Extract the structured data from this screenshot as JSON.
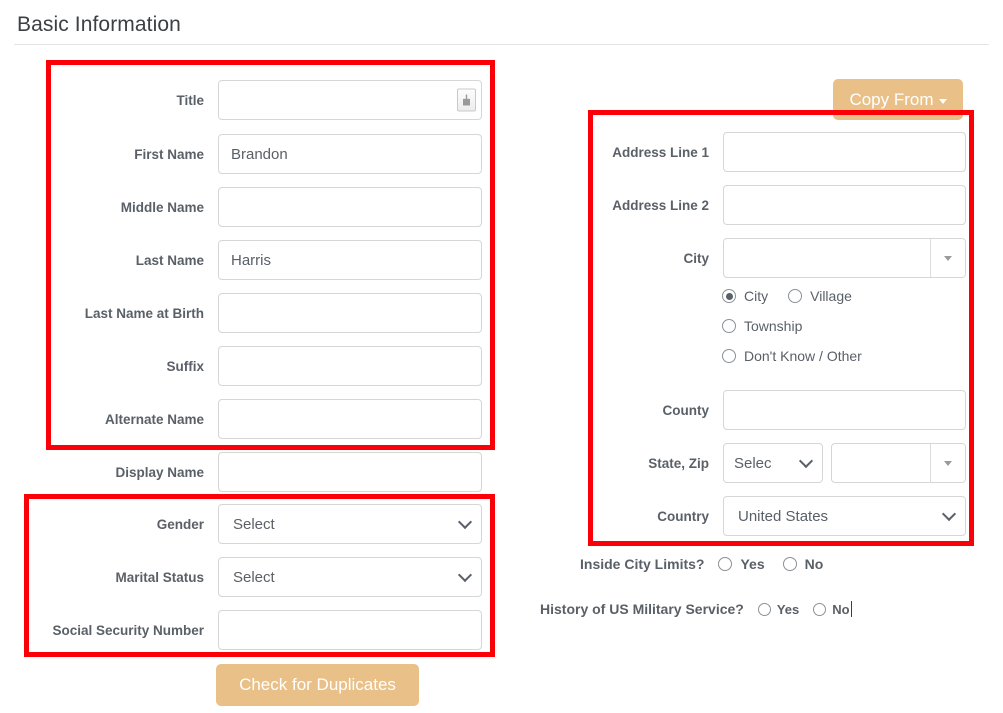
{
  "header": {
    "title": "Basic Information"
  },
  "colors": {
    "accent_button": "#e8c088",
    "annotation": "#fb0007",
    "label_text": "#5a6067",
    "input_border": "#d6d6d6"
  },
  "left_column": {
    "fields": [
      {
        "label": "Title",
        "value": "",
        "placeholder": "",
        "type": "text-with-picker",
        "icon": "spinner-picker-icon"
      },
      {
        "label": "First Name",
        "value": "Brandon",
        "placeholder": "",
        "type": "text"
      },
      {
        "label": "Middle Name",
        "value": "",
        "placeholder": "",
        "type": "text"
      },
      {
        "label": "Last Name",
        "value": "Harris",
        "placeholder": "",
        "type": "text"
      },
      {
        "label": "Last Name at Birth",
        "value": "",
        "placeholder": "",
        "type": "text"
      },
      {
        "label": "Suffix",
        "value": "",
        "placeholder": "",
        "type": "text"
      },
      {
        "label": "Alternate Name",
        "value": "",
        "placeholder": "",
        "type": "text"
      },
      {
        "label": "Display Name",
        "value": "",
        "placeholder": "",
        "type": "text"
      },
      {
        "label": "Gender",
        "value": "Select",
        "type": "select"
      },
      {
        "label": "Marital Status",
        "value": "Select",
        "type": "select"
      },
      {
        "label": "Social Security Number",
        "value": "",
        "placeholder": "",
        "type": "text"
      }
    ],
    "check_duplicates_label": "Check for Duplicates"
  },
  "right_column": {
    "copy_from_label": "Copy From",
    "fields": [
      {
        "label": "Address Line 1",
        "value": "",
        "placeholder": "",
        "type": "text"
      },
      {
        "label": "Address Line 2",
        "value": "",
        "placeholder": "",
        "type": "text"
      },
      {
        "label": "City",
        "value": "",
        "placeholder": "",
        "type": "combo"
      },
      {
        "label": "County",
        "value": "",
        "placeholder": "",
        "type": "text"
      },
      {
        "label": "State, Zip",
        "state_value": "Selec",
        "zip_value": "",
        "zip_placeholder": "",
        "type": "state-zip"
      },
      {
        "label": "Country",
        "value": "United States",
        "type": "select"
      }
    ],
    "place_type": {
      "options": [
        {
          "label": "City",
          "selected": true
        },
        {
          "label": "Village",
          "selected": false
        },
        {
          "label": "Township",
          "selected": false
        },
        {
          "label": "Don't Know / Other",
          "selected": false
        }
      ]
    },
    "questions": [
      {
        "text": "Inside City Limits?",
        "options": [
          {
            "label": "Yes",
            "selected": false
          },
          {
            "label": "No",
            "selected": false
          }
        ]
      },
      {
        "text": "History of US Military Service?",
        "options": [
          {
            "label": "Yes",
            "selected": false
          },
          {
            "label": "No",
            "selected": false
          }
        ]
      }
    ]
  }
}
